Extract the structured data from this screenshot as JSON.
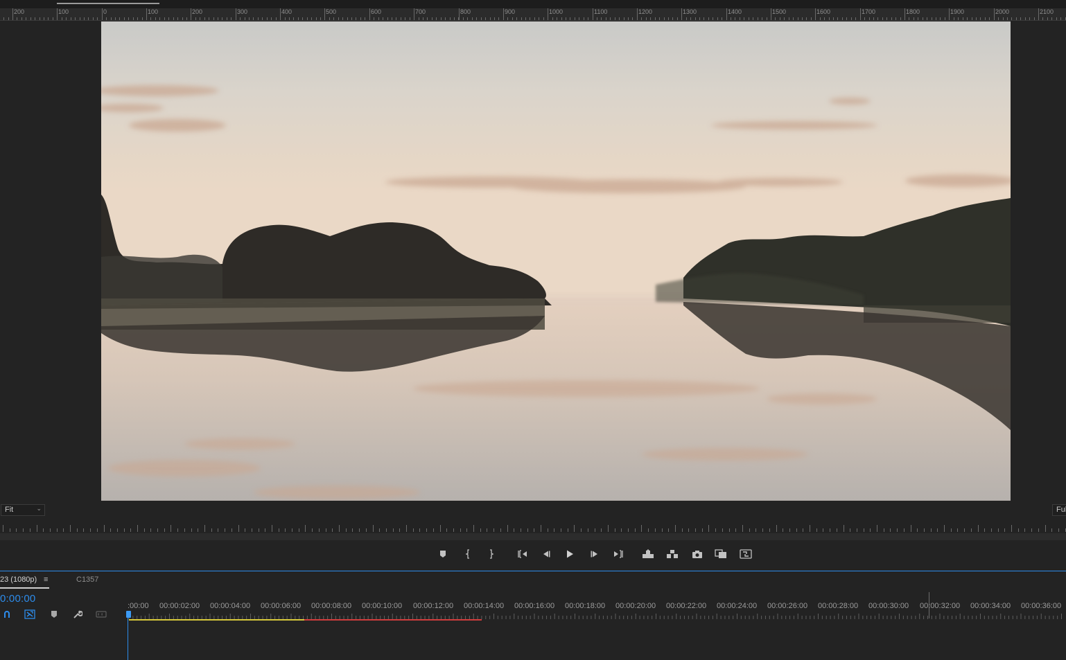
{
  "ruler": {
    "labels": [
      "200",
      "100",
      "0",
      "100",
      "200",
      "300",
      "400",
      "500",
      "600",
      "700",
      "800",
      "900",
      "1000",
      "1100",
      "1200",
      "1300",
      "1400",
      "1500",
      "1600",
      "1700",
      "1800",
      "1900",
      "2000",
      "2100"
    ]
  },
  "viewer": {
    "fit_label": "Fit",
    "fit_chevron": "⌄",
    "full_label": "Full"
  },
  "transport": {
    "buttons": [
      {
        "name": "add-marker-button",
        "icon": "marker-icon"
      },
      {
        "name": "mark-in-button",
        "icon": "mark-in-icon"
      },
      {
        "name": "mark-out-button",
        "icon": "mark-out-icon"
      },
      {
        "name": "go-to-in-button",
        "icon": "go-to-in-icon"
      },
      {
        "name": "step-back-button",
        "icon": "step-back-icon"
      },
      {
        "name": "play-button",
        "icon": "play-icon"
      },
      {
        "name": "step-forward-button",
        "icon": "step-forward-icon"
      },
      {
        "name": "go-to-out-button",
        "icon": "go-to-out-icon"
      },
      {
        "name": "lift-button",
        "icon": "lift-icon"
      },
      {
        "name": "extract-button",
        "icon": "extract-icon"
      },
      {
        "name": "export-frame-button",
        "icon": "camera-icon"
      },
      {
        "name": "comparison-view-button",
        "icon": "comparison-icon"
      },
      {
        "name": "proxy-toggle-button",
        "icon": "proxy-icon"
      }
    ]
  },
  "timeline": {
    "sequence_tab": "23 (1080p)",
    "sequence_menu": "≡",
    "clip_tab": "C1357",
    "timecode": "0:00:00",
    "time_labels": [
      ":00:00",
      "00:00:02:00",
      "00:00:04:00",
      "00:00:06:00",
      "00:00:08:00",
      "00:00:10:00",
      "00:00:12:00",
      "00:00:14:00",
      "00:00:16:00",
      "00:00:18:00",
      "00:00:20:00",
      "00:00:22:00",
      "00:00:24:00",
      "00:00:26:00",
      "00:00:28:00",
      "00:00:30:00",
      "00:00:32:00",
      "00:00:34:00",
      "00:00:36:00"
    ]
  },
  "colors": {
    "accent": "#2d8ceb",
    "work_area_rendered": "#d8c93a",
    "work_area_unrendered": "#d23c3c"
  }
}
